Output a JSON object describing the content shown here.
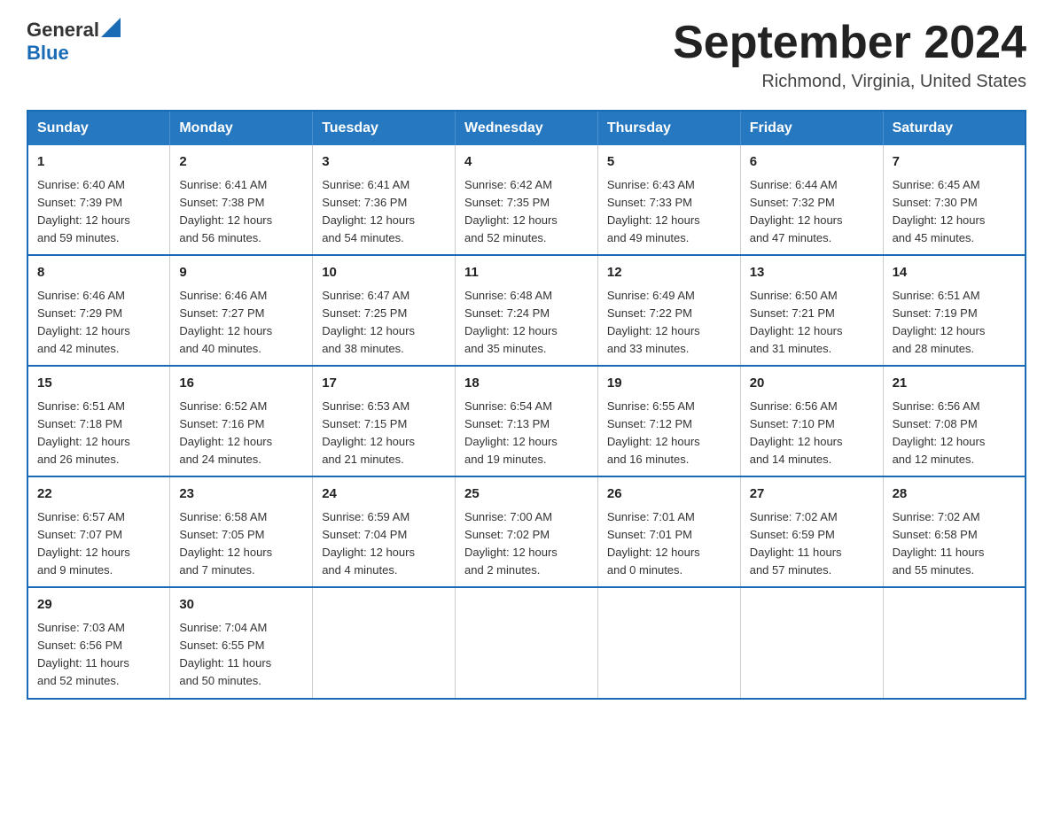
{
  "logo": {
    "general": "General",
    "blue": "Blue"
  },
  "title": "September 2024",
  "location": "Richmond, Virginia, United States",
  "headers": [
    "Sunday",
    "Monday",
    "Tuesday",
    "Wednesday",
    "Thursday",
    "Friday",
    "Saturday"
  ],
  "weeks": [
    [
      {
        "day": "1",
        "sunrise": "6:40 AM",
        "sunset": "7:39 PM",
        "daylight": "12 hours and 59 minutes."
      },
      {
        "day": "2",
        "sunrise": "6:41 AM",
        "sunset": "7:38 PM",
        "daylight": "12 hours and 56 minutes."
      },
      {
        "day": "3",
        "sunrise": "6:41 AM",
        "sunset": "7:36 PM",
        "daylight": "12 hours and 54 minutes."
      },
      {
        "day": "4",
        "sunrise": "6:42 AM",
        "sunset": "7:35 PM",
        "daylight": "12 hours and 52 minutes."
      },
      {
        "day": "5",
        "sunrise": "6:43 AM",
        "sunset": "7:33 PM",
        "daylight": "12 hours and 49 minutes."
      },
      {
        "day": "6",
        "sunrise": "6:44 AM",
        "sunset": "7:32 PM",
        "daylight": "12 hours and 47 minutes."
      },
      {
        "day": "7",
        "sunrise": "6:45 AM",
        "sunset": "7:30 PM",
        "daylight": "12 hours and 45 minutes."
      }
    ],
    [
      {
        "day": "8",
        "sunrise": "6:46 AM",
        "sunset": "7:29 PM",
        "daylight": "12 hours and 42 minutes."
      },
      {
        "day": "9",
        "sunrise": "6:46 AM",
        "sunset": "7:27 PM",
        "daylight": "12 hours and 40 minutes."
      },
      {
        "day": "10",
        "sunrise": "6:47 AM",
        "sunset": "7:25 PM",
        "daylight": "12 hours and 38 minutes."
      },
      {
        "day": "11",
        "sunrise": "6:48 AM",
        "sunset": "7:24 PM",
        "daylight": "12 hours and 35 minutes."
      },
      {
        "day": "12",
        "sunrise": "6:49 AM",
        "sunset": "7:22 PM",
        "daylight": "12 hours and 33 minutes."
      },
      {
        "day": "13",
        "sunrise": "6:50 AM",
        "sunset": "7:21 PM",
        "daylight": "12 hours and 31 minutes."
      },
      {
        "day": "14",
        "sunrise": "6:51 AM",
        "sunset": "7:19 PM",
        "daylight": "12 hours and 28 minutes."
      }
    ],
    [
      {
        "day": "15",
        "sunrise": "6:51 AM",
        "sunset": "7:18 PM",
        "daylight": "12 hours and 26 minutes."
      },
      {
        "day": "16",
        "sunrise": "6:52 AM",
        "sunset": "7:16 PM",
        "daylight": "12 hours and 24 minutes."
      },
      {
        "day": "17",
        "sunrise": "6:53 AM",
        "sunset": "7:15 PM",
        "daylight": "12 hours and 21 minutes."
      },
      {
        "day": "18",
        "sunrise": "6:54 AM",
        "sunset": "7:13 PM",
        "daylight": "12 hours and 19 minutes."
      },
      {
        "day": "19",
        "sunrise": "6:55 AM",
        "sunset": "7:12 PM",
        "daylight": "12 hours and 16 minutes."
      },
      {
        "day": "20",
        "sunrise": "6:56 AM",
        "sunset": "7:10 PM",
        "daylight": "12 hours and 14 minutes."
      },
      {
        "day": "21",
        "sunrise": "6:56 AM",
        "sunset": "7:08 PM",
        "daylight": "12 hours and 12 minutes."
      }
    ],
    [
      {
        "day": "22",
        "sunrise": "6:57 AM",
        "sunset": "7:07 PM",
        "daylight": "12 hours and 9 minutes."
      },
      {
        "day": "23",
        "sunrise": "6:58 AM",
        "sunset": "7:05 PM",
        "daylight": "12 hours and 7 minutes."
      },
      {
        "day": "24",
        "sunrise": "6:59 AM",
        "sunset": "7:04 PM",
        "daylight": "12 hours and 4 minutes."
      },
      {
        "day": "25",
        "sunrise": "7:00 AM",
        "sunset": "7:02 PM",
        "daylight": "12 hours and 2 minutes."
      },
      {
        "day": "26",
        "sunrise": "7:01 AM",
        "sunset": "7:01 PM",
        "daylight": "12 hours and 0 minutes."
      },
      {
        "day": "27",
        "sunrise": "7:02 AM",
        "sunset": "6:59 PM",
        "daylight": "11 hours and 57 minutes."
      },
      {
        "day": "28",
        "sunrise": "7:02 AM",
        "sunset": "6:58 PM",
        "daylight": "11 hours and 55 minutes."
      }
    ],
    [
      {
        "day": "29",
        "sunrise": "7:03 AM",
        "sunset": "6:56 PM",
        "daylight": "11 hours and 52 minutes."
      },
      {
        "day": "30",
        "sunrise": "7:04 AM",
        "sunset": "6:55 PM",
        "daylight": "11 hours and 50 minutes."
      },
      null,
      null,
      null,
      null,
      null
    ]
  ],
  "labels": {
    "sunrise": "Sunrise:",
    "sunset": "Sunset:",
    "daylight": "Daylight:"
  }
}
